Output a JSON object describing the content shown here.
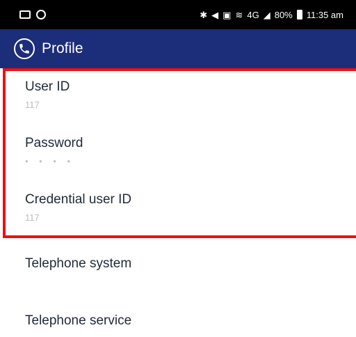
{
  "status_bar": {
    "time": "11:35 am",
    "battery": "80%",
    "signal_text": "4G",
    "icons": [
      "image-icon",
      "sync-icon",
      "bluetooth-icon",
      "mute-icon",
      "vibrate-icon",
      "lte-icon",
      "wifi-icon",
      "signal-icon",
      "battery-icon"
    ]
  },
  "app_bar": {
    "title": "Profile",
    "icon": "phone-circle-icon",
    "color": "#1c2d7a"
  },
  "profile": {
    "items": [
      {
        "label": "User ID",
        "value": "117"
      },
      {
        "label": "Password",
        "value": "• • • •"
      },
      {
        "label": "Credential user ID",
        "value": "117"
      },
      {
        "label": "Telephone system"
      },
      {
        "label": "Telephone service"
      }
    ]
  },
  "highlight": {
    "color": "#ee1111"
  }
}
